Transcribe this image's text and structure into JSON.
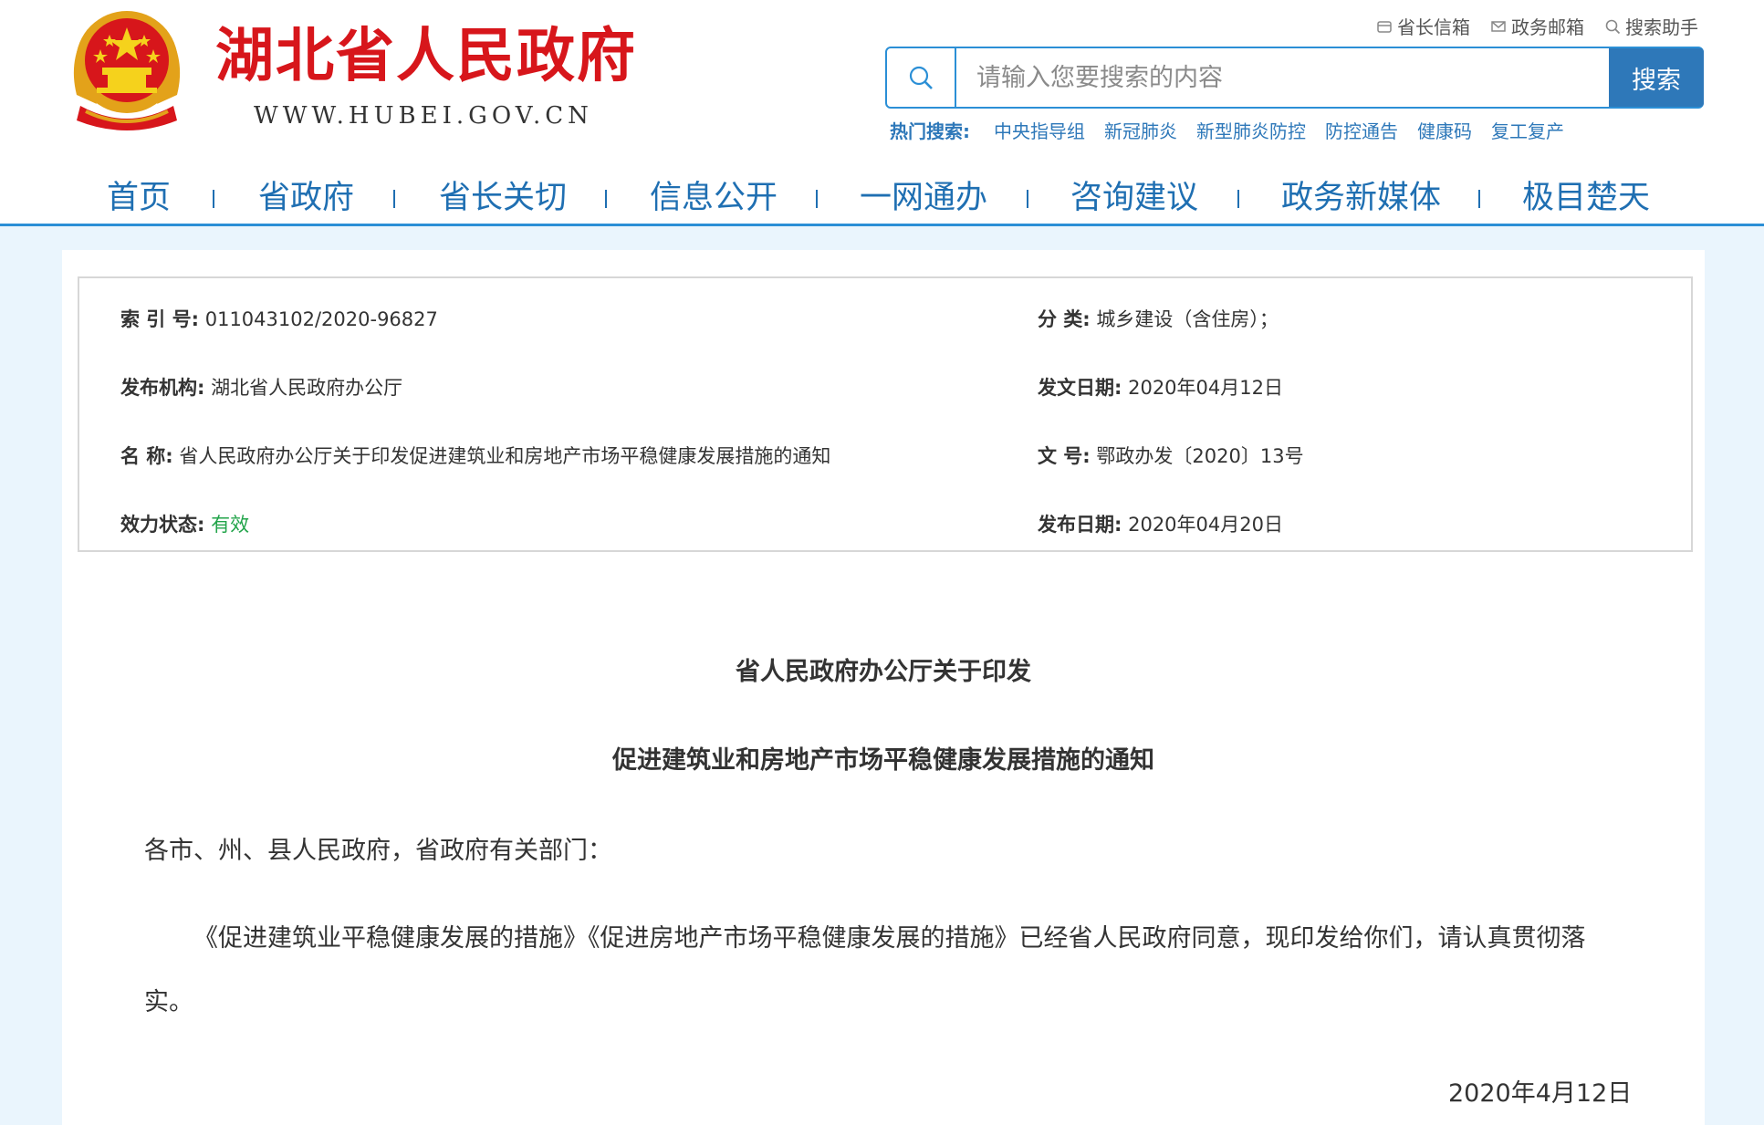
{
  "header": {
    "site_name": "湖北省人民政府",
    "site_url": "WWW.HUBEI.GOV.CN",
    "top_links": [
      {
        "label": "省长信箱",
        "icon": "mailbox-icon"
      },
      {
        "label": "政务邮箱",
        "icon": "envelope-icon"
      },
      {
        "label": "搜索助手",
        "icon": "search-icon"
      }
    ],
    "search": {
      "placeholder": "请输入您要搜索的内容",
      "button_label": "搜索"
    },
    "hot_search": {
      "label": "热门搜索:",
      "items": [
        "中央指导组",
        "新冠肺炎",
        "新型肺炎防控",
        "防控通告",
        "健康码",
        "复工复产"
      ]
    },
    "nav": [
      "首页",
      "省政府",
      "省长关切",
      "信息公开",
      "一网通办",
      "咨询建议",
      "政务新媒体",
      "极目楚天"
    ]
  },
  "meta": {
    "index_no": {
      "label": "索 引 号:",
      "value": "011043102/2020-96827"
    },
    "category": {
      "label": "分    类:",
      "value": "城乡建设（含住房）；"
    },
    "publisher": {
      "label": "发布机构:",
      "value": "湖北省人民政府办公厅"
    },
    "issue_date": {
      "label": "发文日期:",
      "value": "2020年04月12日"
    },
    "name": {
      "label": "名    称:",
      "value": "省人民政府办公厅关于印发促进建筑业和房地产市场平稳健康发展措施的通知"
    },
    "doc_no": {
      "label": "文    号:",
      "value": "鄂政办发〔2020〕13号"
    },
    "status": {
      "label": "效力状态:",
      "value": "有效"
    },
    "publish_date": {
      "label": "发布日期:",
      "value": "2020年04月20日"
    }
  },
  "article": {
    "title_line1": "省人民政府办公厅关于印发",
    "title_line2": "促进建筑业和房地产市场平稳健康发展措施的通知",
    "salutation": "各市、州、县人民政府，省政府有关部门：",
    "body_line1": "《促进建筑业平稳健康发展的措施》《促进房地产市场平稳健康发展的措施》已经省人民政府同意，现印发给你们，请认真贯彻落",
    "body_line2": "实。",
    "date": "2020年4月12日"
  },
  "colors": {
    "brand_red": "#d7161b",
    "brand_blue": "#2b8fd6",
    "nav_blue": "#1f6fb2",
    "status_green": "#22a44a"
  }
}
